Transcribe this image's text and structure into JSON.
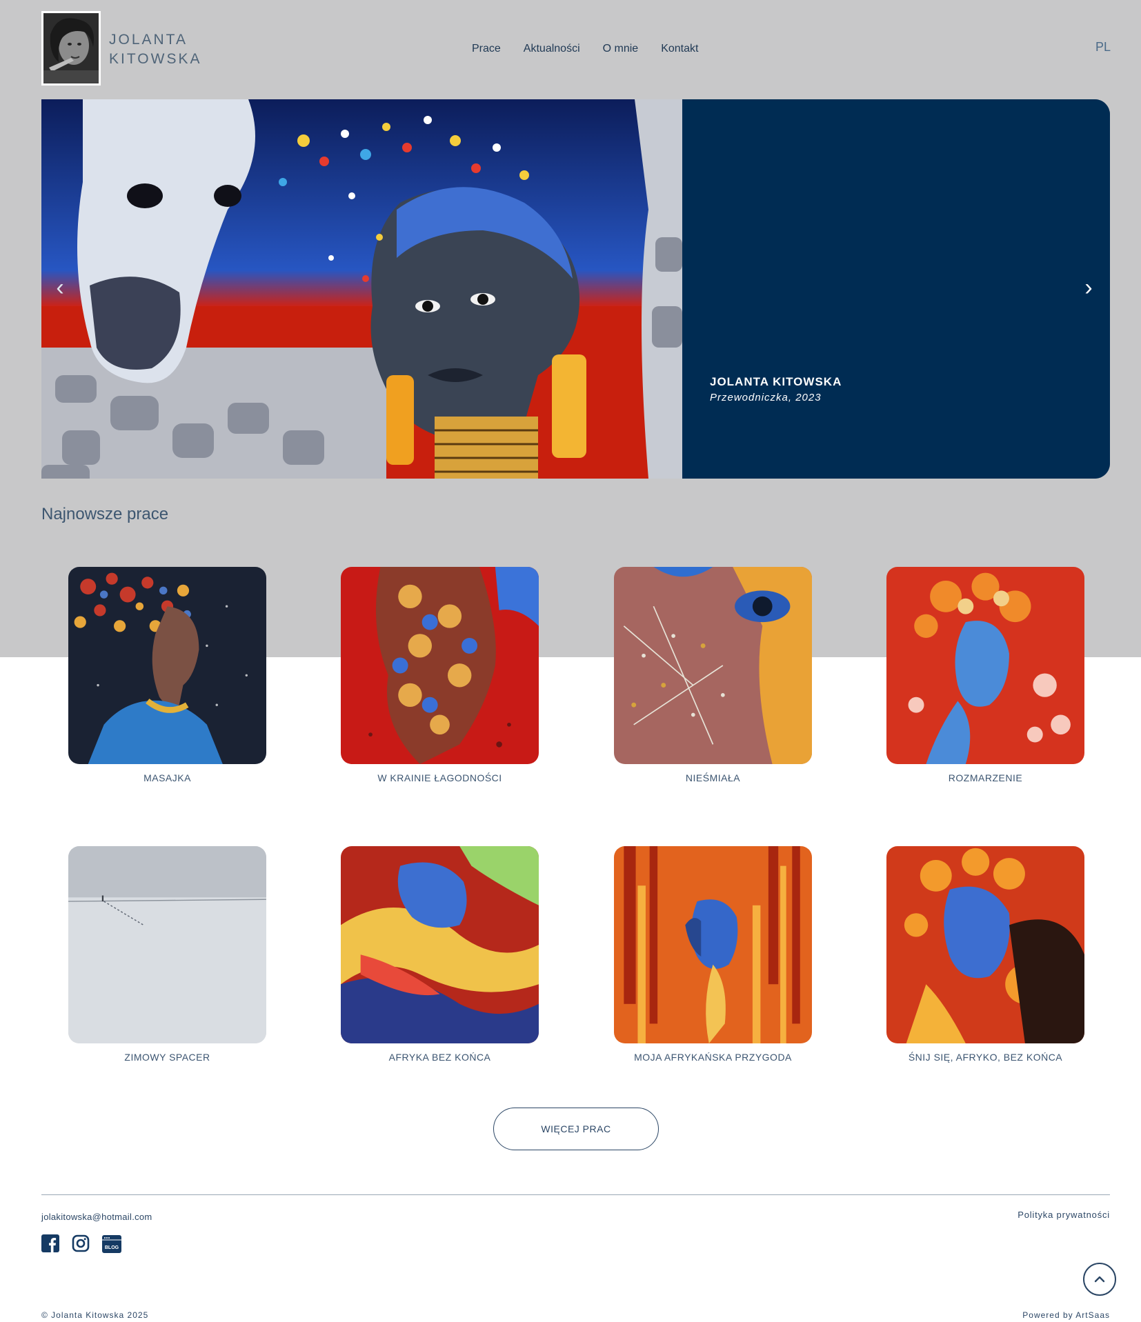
{
  "brand": {
    "line1": "JOLANTA",
    "line2": "KITOWSKA"
  },
  "nav": {
    "items": [
      "Prace",
      "Aktualności",
      "O mnie",
      "Kontakt"
    ]
  },
  "language": "PL",
  "hero": {
    "name": "JOLANTA KITOWSKA",
    "subtitle": "Przewodniczka, 2023",
    "prev_icon": "chevron-left-icon",
    "next_icon": "chevron-right-icon"
  },
  "section_title": "Najnowsze prace",
  "works": [
    {
      "title": "MASAJKA"
    },
    {
      "title": "W KRAINIE ŁAGODNOŚCI"
    },
    {
      "title": "NIEŚMIAŁA"
    },
    {
      "title": "ROZMARZENIE"
    },
    {
      "title": "ZIMOWY SPACER"
    },
    {
      "title": "AFRYKA BEZ KOŃCA"
    },
    {
      "title": "MOJA AFRYKAŃSKA PRZYGODA"
    },
    {
      "title": "ŚNIJ SIĘ, AFRYKO, BEZ KOŃCA"
    }
  ],
  "more_button": "WIĘCEJ PRAC",
  "footer": {
    "email": "jolakitowska@hotmail.com",
    "privacy": "Polityka prywatności",
    "copyright": "© Jolanta Kitowska 2025",
    "powered": "Powered by ArtSaas",
    "social_icons": [
      "facebook-icon",
      "instagram-icon",
      "blog-icon"
    ],
    "blog_badge": "BLOG"
  },
  "colors": {
    "band": "#c8c8c9",
    "navy": "#002c53",
    "text": "#2b4665"
  }
}
